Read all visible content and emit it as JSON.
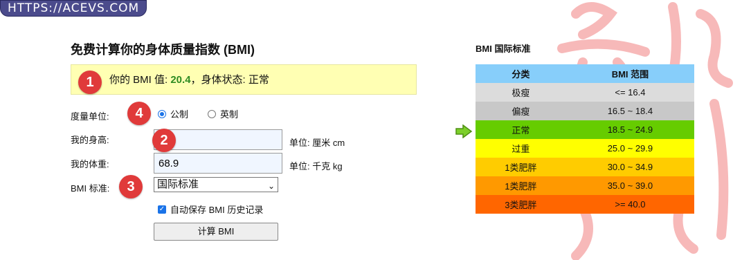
{
  "watermark": "HTTPS://ACEVS.COM",
  "form": {
    "title": "免费计算你的身体质量指数 (BMI)",
    "result_prefix": "你的 BMI 值:",
    "result_value": "20.4",
    "result_mid": "，身体状态:",
    "result_status": "正常",
    "unit_label": "度量单位:",
    "unit_options": [
      "公制",
      "英制"
    ],
    "unit_selected": "公制",
    "height_label": "我的身高:",
    "height_value": "",
    "height_unit": "单位: 厘米 cm",
    "weight_label": "我的体重:",
    "weight_value": "68.9",
    "weight_unit": "单位: 千克 kg",
    "standard_label": "BMI 标准:",
    "standard_value": "国际标准",
    "autosave_label": "自动保存 BMI 历史记录",
    "autosave_checked": true,
    "calc_button": "计算 BMI"
  },
  "markers": [
    "1",
    "2",
    "3",
    "4"
  ],
  "table": {
    "title": "BMI 国际标准",
    "headers": [
      "分类",
      "BMI 范围"
    ],
    "rows": [
      {
        "category": "极瘦",
        "range": "<= 16.4",
        "color": "#dcdcdc"
      },
      {
        "category": "偏瘦",
        "range": "16.5 ~ 18.4",
        "color": "#c8c8c8"
      },
      {
        "category": "正常",
        "range": "18.5 ~ 24.9",
        "color": "#66cc00"
      },
      {
        "category": "过重",
        "range": "25.0 ~ 29.9",
        "color": "#ffff00"
      },
      {
        "category": "1类肥胖",
        "range": "30.0 ~ 34.9",
        "color": "#ffcc00"
      },
      {
        "category": "1类肥胖",
        "range": "35.0 ~ 39.0",
        "color": "#ff9900"
      },
      {
        "category": "3类肥胖",
        "range": ">= 40.0",
        "color": "#ff6600"
      }
    ],
    "current_row": 2
  }
}
